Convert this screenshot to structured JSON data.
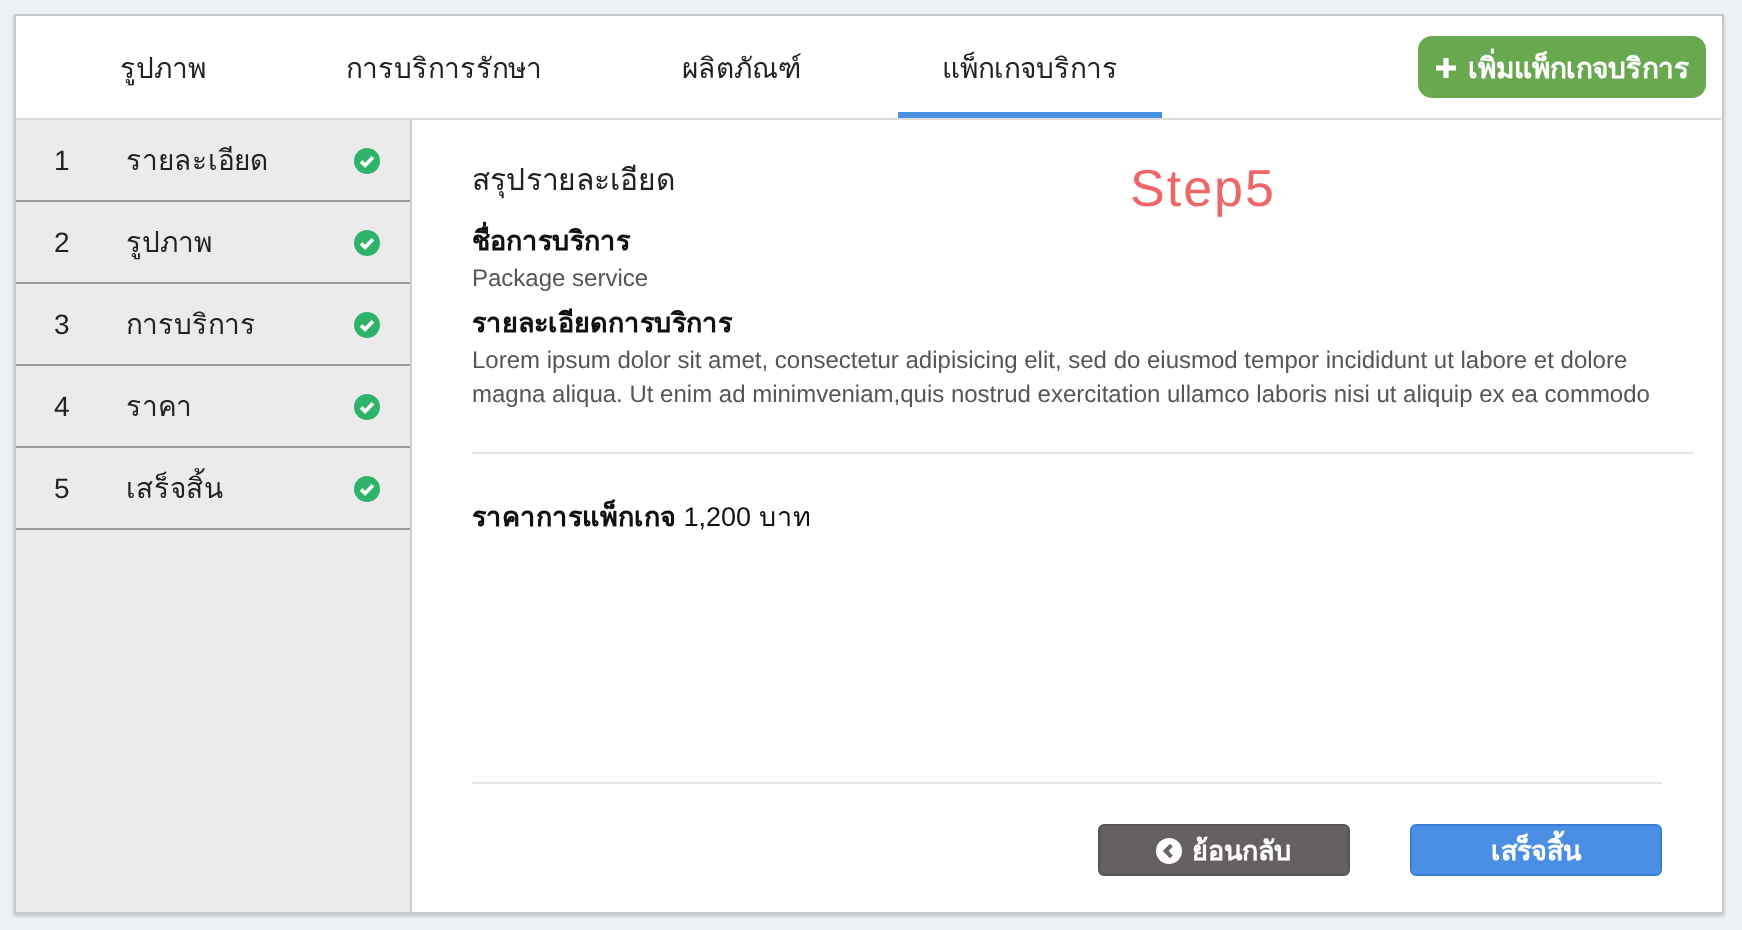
{
  "tabs": [
    {
      "label": "รูปภาพ",
      "selected": false
    },
    {
      "label": "การบริการรักษา",
      "selected": false
    },
    {
      "label": "ผลิตภัณฑ์",
      "selected": false
    },
    {
      "label": "แพ็กเกจบริการ",
      "selected": true
    }
  ],
  "add_button": {
    "label": "เพิ่มแพ็กเกจบริการ"
  },
  "steps": [
    {
      "number": "1",
      "label": "รายละเอียด",
      "done": true
    },
    {
      "number": "2",
      "label": "รูปภาพ",
      "done": true
    },
    {
      "number": "3",
      "label": "การบริการ",
      "done": true
    },
    {
      "number": "4",
      "label": "ราคา",
      "done": true
    },
    {
      "number": "5",
      "label": "เสร็จสิ้น",
      "done": true
    }
  ],
  "summary": {
    "title": "สรุปรายละเอียด",
    "annotation": "Step5",
    "fields": [
      {
        "label": "ชื่อการบริการ",
        "value": "Package service"
      },
      {
        "label": "รายละเอียดการบริการ",
        "value": "Lorem ipsum dolor sit amet, consectetur adipisicing elit, sed do eiusmod tempor incididunt ut labore et dolore magna aliqua. Ut enim ad minimveniam,quis nostrud exercitation ullamco laboris nisi ut aliquip ex ea commodo"
      }
    ],
    "price_label": "ราคาการแพ็กเกจ",
    "price_value": "1,200 บาท"
  },
  "buttons": {
    "back": "ย้อนกลับ",
    "finish": "เสร็จสิ้น"
  }
}
